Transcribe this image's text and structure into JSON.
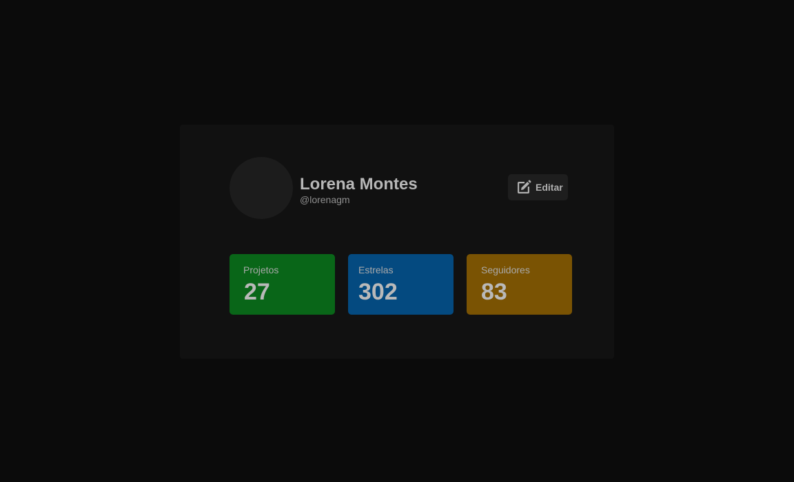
{
  "profile": {
    "name": "Lorena Montes",
    "handle": "@lorenagm",
    "edit_label": "Editar"
  },
  "stats": [
    {
      "label": "Projetos",
      "value": "27",
      "color": "#096618"
    },
    {
      "label": "Estrelas",
      "value": "302",
      "color": "#044a80"
    },
    {
      "label": "Seguidores",
      "value": "83",
      "color": "#7a5303"
    }
  ],
  "colors": {
    "background": "#0b0b0b",
    "card": "#111111",
    "avatar": "#1c1c1c",
    "edit_button": "#1e1e1e"
  },
  "icons": {
    "edit": "edit-square-icon"
  }
}
